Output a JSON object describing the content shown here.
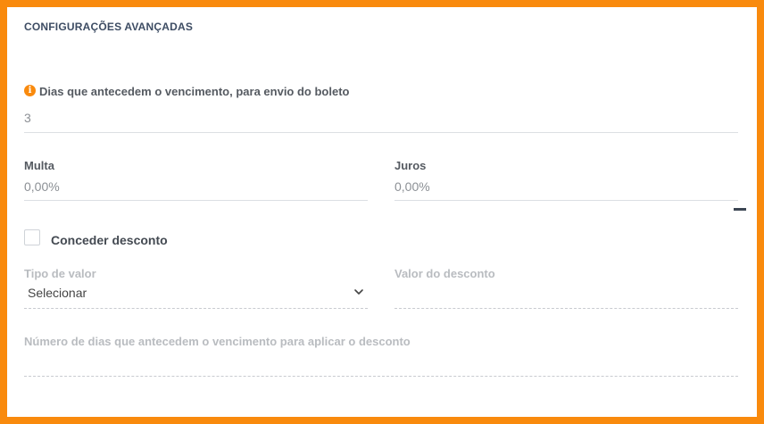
{
  "section": {
    "title": "CONFIGURAÇÕES AVANÇADAS"
  },
  "days_before_due": {
    "icon": "info-icon",
    "label": "Dias que antecedem o vencimento, para envio do boleto",
    "value": "3"
  },
  "multa": {
    "label": "Multa",
    "value": "0,00%"
  },
  "juros": {
    "label": "Juros",
    "value": "0,00%"
  },
  "discount": {
    "checkbox_label": "Conceder desconto",
    "checked": false,
    "value_type_label": "Tipo de valor",
    "value_type_selected": "Selecionar",
    "discount_value_label": "Valor do desconto",
    "days_label": "Número de dias que antecedem o vencimento para aplicar o desconto"
  },
  "colors": {
    "accent": "#f98a0d",
    "heading": "#3d4c63"
  }
}
